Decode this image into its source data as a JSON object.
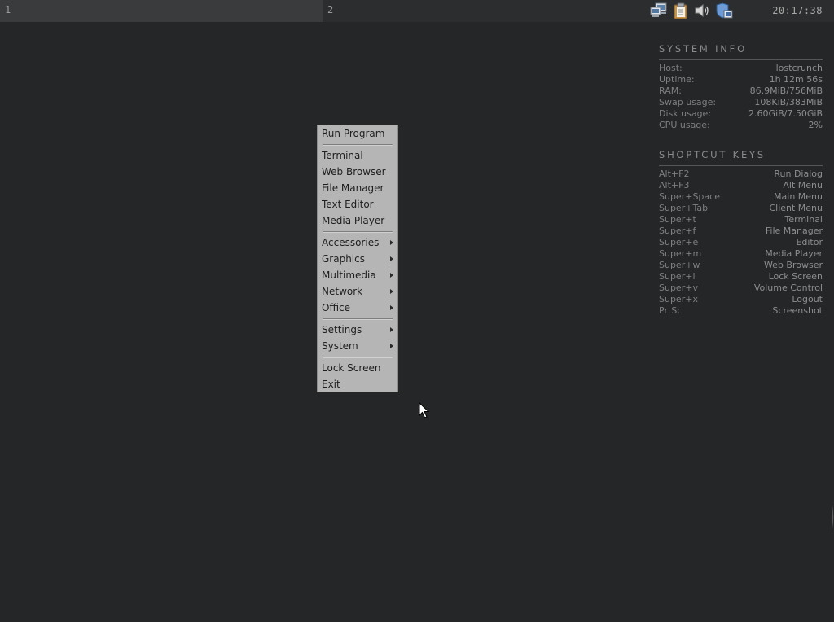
{
  "panel": {
    "workspaces": [
      {
        "label": "1",
        "active": true
      },
      {
        "label": "2",
        "active": false
      }
    ],
    "tray_icons": [
      "network-icon",
      "clipboard-icon",
      "volume-icon",
      "update-shield-icon"
    ],
    "clock": "20:17:38"
  },
  "conky": {
    "system_info": {
      "title": "SYSTEM INFO",
      "rows": [
        {
          "label": "Host:",
          "value": "lostcrunch"
        },
        {
          "label": "Uptime:",
          "value": "1h 12m 56s"
        },
        {
          "label": "RAM:",
          "value": "86.9MiB/756MiB"
        },
        {
          "label": "Swap usage:",
          "value": "108KiB/383MiB"
        },
        {
          "label": "Disk usage:",
          "value": "2.60GiB/7.50GiB"
        },
        {
          "label": "CPU usage:",
          "value": "2%"
        }
      ]
    },
    "shortcut_keys": {
      "title": "SHOPTCUT KEYS",
      "rows": [
        {
          "key": "Alt+F2",
          "action": "Run Dialog"
        },
        {
          "key": "Alt+F3",
          "action": "Alt Menu"
        },
        {
          "key": "Super+Space",
          "action": "Main Menu"
        },
        {
          "key": "Super+Tab",
          "action": "Client Menu"
        },
        {
          "key": "Super+t",
          "action": "Terminal"
        },
        {
          "key": "Super+f",
          "action": "File Manager"
        },
        {
          "key": "Super+e",
          "action": "Editor"
        },
        {
          "key": "Super+m",
          "action": "Media Player"
        },
        {
          "key": "Super+w",
          "action": "Web Browser"
        },
        {
          "key": "Super+l",
          "action": "Lock Screen"
        },
        {
          "key": "Super+v",
          "action": "Volume Control"
        },
        {
          "key": "Super+x",
          "action": "Logout"
        },
        {
          "key": "PrtSc",
          "action": "Screenshot"
        }
      ]
    }
  },
  "menu": {
    "items": [
      {
        "label": "Run Program"
      },
      {
        "separator": true
      },
      {
        "label": "Terminal"
      },
      {
        "label": "Web Browser"
      },
      {
        "label": "File Manager"
      },
      {
        "label": "Text Editor"
      },
      {
        "label": "Media Player"
      },
      {
        "separator": true
      },
      {
        "label": "Accessories",
        "submenu": true
      },
      {
        "label": "Graphics",
        "submenu": true
      },
      {
        "label": "Multimedia",
        "submenu": true
      },
      {
        "label": "Network",
        "submenu": true
      },
      {
        "label": "Office",
        "submenu": true
      },
      {
        "separator": true
      },
      {
        "label": "Settings",
        "submenu": true
      },
      {
        "label": "System",
        "submenu": true
      },
      {
        "separator": true
      },
      {
        "label": "Lock Screen"
      },
      {
        "label": "Exit"
      }
    ]
  },
  "colors": {
    "desktop": "#252627",
    "panel": "#2c2d2e",
    "menu_bg": "#b5b5b5",
    "conky_text": "#7e7f80"
  }
}
